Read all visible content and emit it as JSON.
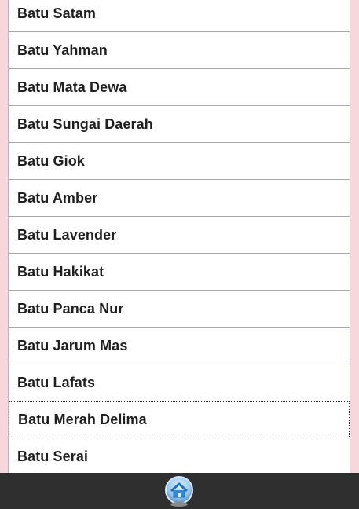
{
  "list": {
    "items": [
      {
        "label": "Batu Satam"
      },
      {
        "label": "Batu Yahman"
      },
      {
        "label": "Batu Mata Dewa"
      },
      {
        "label": "Batu Sungai Daerah"
      },
      {
        "label": "Batu Giok"
      },
      {
        "label": "Batu Amber"
      },
      {
        "label": "Batu Lavender"
      },
      {
        "label": "Batu Hakikat"
      },
      {
        "label": "Batu Panca Nur"
      },
      {
        "label": "Batu Jarum Mas"
      },
      {
        "label": "Batu Lafats"
      },
      {
        "label": "Batu Merah Delima",
        "focused": true
      },
      {
        "label": "Batu Serai"
      }
    ]
  },
  "bottom_bar": {
    "home_icon": "home-icon"
  },
  "colors": {
    "page_background": "#f7d6dc",
    "bar_background": "#2f2f2f",
    "icon_blue": "#2f88d8"
  }
}
